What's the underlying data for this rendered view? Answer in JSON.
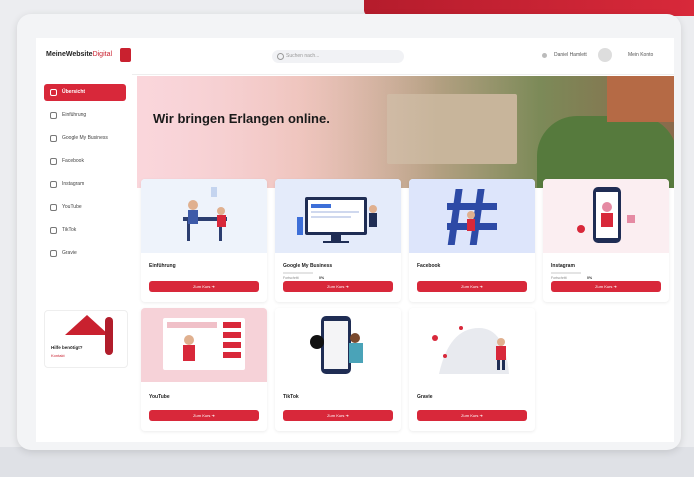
{
  "header": {
    "logo_text": "MeineWebsite",
    "logo_accent": "Digital",
    "search_placeholder": "Suchen nach...",
    "user_name": "Daniel Hamlett",
    "account_label": "Mein Konto"
  },
  "sidebar": {
    "items": [
      {
        "label": "Übersicht",
        "icon": "home-icon",
        "active": true
      },
      {
        "label": "Einführung",
        "icon": "book-icon",
        "active": false
      },
      {
        "label": "Google My Business",
        "icon": "google-icon",
        "active": false
      },
      {
        "label": "Facebook",
        "icon": "facebook-icon",
        "active": false
      },
      {
        "label": "Instagram",
        "icon": "instagram-icon",
        "active": false
      },
      {
        "label": "YouTube",
        "icon": "youtube-icon",
        "active": false
      },
      {
        "label": "TikTok",
        "icon": "tiktok-icon",
        "active": false
      },
      {
        "label": "Gravie",
        "icon": "globe-icon",
        "active": false
      }
    ],
    "promo": {
      "title": "Hilfe benötigt?",
      "link": "Kontakt"
    }
  },
  "hero": {
    "title": "Wir bringen Erlangen online."
  },
  "cards": [
    {
      "title": "Einführung",
      "button": "Zum Kurs ➜",
      "progress_label": "",
      "progress_value": "",
      "progress_fraction": 0
    },
    {
      "title": "Google My Business",
      "button": "Zum Kurs ➜",
      "progress_label": "Fortschritt",
      "progress_value": "0%",
      "progress_fraction": 0.0
    },
    {
      "title": "Facebook",
      "button": "Zum Kurs ➜",
      "progress_label": "",
      "progress_value": "",
      "progress_fraction": 0
    },
    {
      "title": "Instagram",
      "button": "Zum Kurs ➜",
      "progress_label": "Fortschritt",
      "progress_value": "0%",
      "progress_fraction": 0.0
    },
    {
      "title": "YouTube",
      "button": "Zum Kurs ➜"
    },
    {
      "title": "TikTok",
      "button": "Zum Kurs ➜"
    },
    {
      "title": "Gravie",
      "button": "Zum Kurs ➜"
    }
  ],
  "colors": {
    "accent": "#d8283a",
    "progress": "#4fb98d"
  }
}
